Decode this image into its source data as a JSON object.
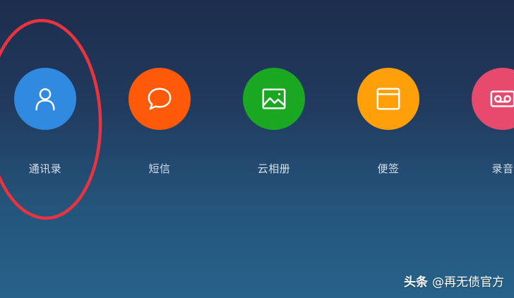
{
  "apps": [
    {
      "label": "通讯录",
      "icon": "contacts-icon",
      "color": "#2f8ae0"
    },
    {
      "label": "短信",
      "icon": "message-bubble-icon",
      "color": "#ff5a0a"
    },
    {
      "label": "云相册",
      "icon": "image-icon",
      "color": "#1aa823"
    },
    {
      "label": "便签",
      "icon": "notes-icon",
      "color": "#ff9f0a"
    },
    {
      "label": "录音",
      "icon": "recorder-icon",
      "color": "#e84a6e"
    }
  ],
  "annotation": {
    "color": "#e8343f",
    "target": "通讯录"
  },
  "watermark": {
    "brand": "头条",
    "handle": "@再无债官方"
  }
}
